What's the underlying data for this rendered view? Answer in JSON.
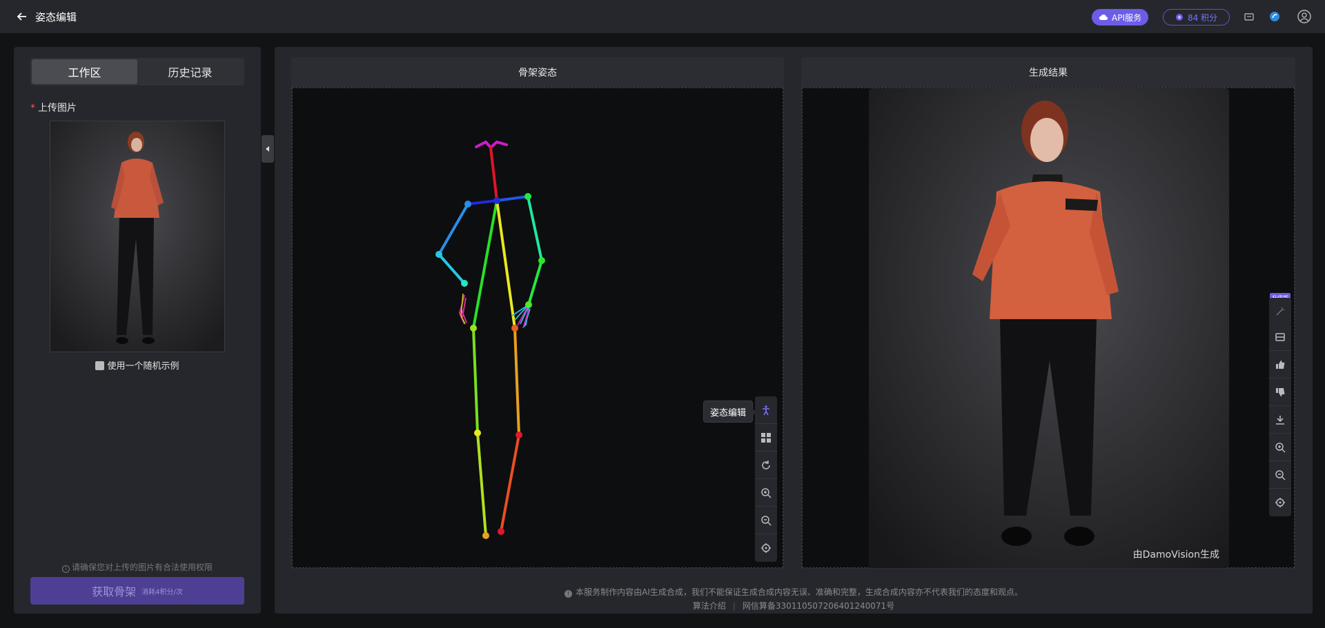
{
  "header": {
    "title": "姿态编辑",
    "api_label": "API服务",
    "points_label": "84 积分"
  },
  "left": {
    "tabs": [
      {
        "label": "工作区",
        "active": true
      },
      {
        "label": "历史记录",
        "active": false
      }
    ],
    "upload_label": "上传图片",
    "random_example": "使用一个随机示例",
    "rights_note": "请确保您对上传的图片有合法使用权限",
    "get_skeleton_label": "获取骨架",
    "get_skeleton_cost": "消耗4积分/次"
  },
  "skeleton_card": {
    "title": "骨架姿态",
    "tooltip": "姿态编辑"
  },
  "result_card": {
    "title": "生成结果",
    "watermark": "由DamoVision生成",
    "vip_badge": "升级版"
  },
  "footer": {
    "disclaimer": "本服务制作内容由AI生成合成，我们不能保证生成合成内容无误、准确和完整，生成合成内容亦不代表我们的态度和观点。",
    "algo_link": "算法介绍",
    "icp": "网信算备330110507206401240071号"
  },
  "colors": {
    "accent": "#6c5ce7",
    "panel": "#25272c",
    "background": "#121314"
  }
}
